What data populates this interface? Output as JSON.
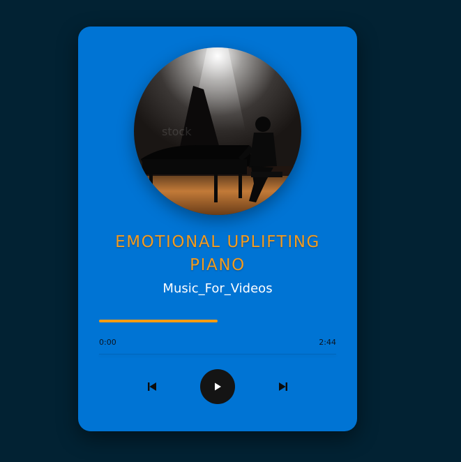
{
  "player": {
    "title": "EMOTIONAL UPLIFTING PIANO",
    "artist": "Music_For_Videos",
    "current_time": "0:00",
    "duration": "2:44",
    "progress_fraction": 0.5,
    "controls": {
      "prev_icon": "skip-previous-icon",
      "play_icon": "play-icon",
      "next_icon": "skip-next-icon"
    },
    "colors": {
      "page_background": "#022233",
      "card_background": "#0074d4",
      "title": "#f29b1f",
      "progress": "#f39c12",
      "play_button": "#141414"
    }
  }
}
